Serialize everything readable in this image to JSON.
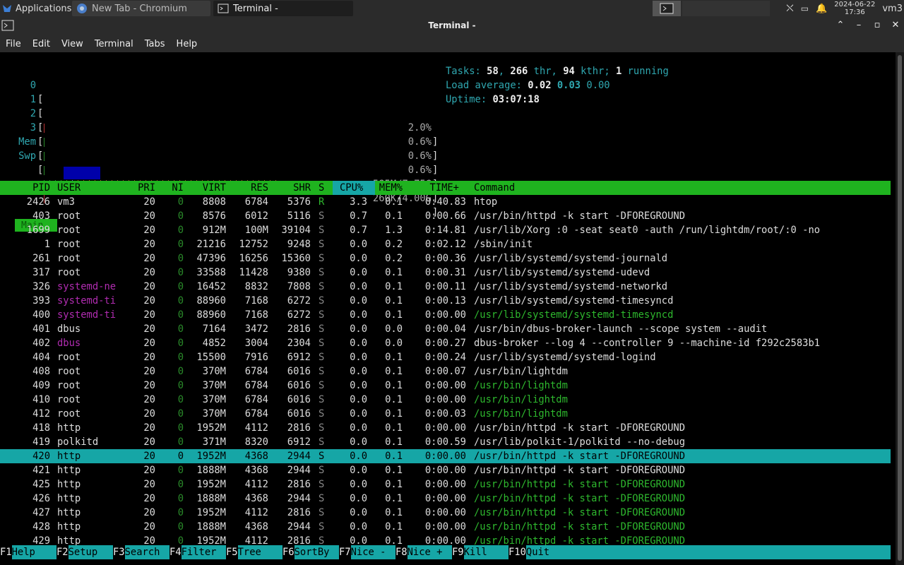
{
  "taskbar": {
    "apps_label": "Applications",
    "tasks": [
      {
        "label": "New Tab - Chromium"
      },
      {
        "label": "Terminal -"
      }
    ],
    "date": "2024-06-22",
    "time": "17:36",
    "user": "vm3"
  },
  "window": {
    "title": "Terminal -"
  },
  "menu": [
    "File",
    "Edit",
    "View",
    "Terminal",
    "Tabs",
    "Help"
  ],
  "meters": {
    "cpus": [
      {
        "label": "0",
        "value": "2.0%"
      },
      {
        "label": "1",
        "value": "0.6%"
      },
      {
        "label": "2",
        "value": "0.6%"
      },
      {
        "label": "3",
        "value": "0.6%"
      }
    ],
    "mem": {
      "label": "Mem",
      "value": "585M/7.75G"
    },
    "swp": {
      "label": "Swp",
      "value": "260K/4.00G"
    }
  },
  "summary": {
    "tasks_label": "Tasks:",
    "tasks": "58",
    "threads": "266",
    "threads_label": "thr,",
    "kthreads": "94",
    "kthreads_label": "kthr;",
    "running": "1",
    "running_label": "running",
    "load_label": "Load average:",
    "load1": "0.02",
    "load5": "0.03",
    "load15": "0.00",
    "uptime_label": "Uptime:",
    "uptime": "03:07:18"
  },
  "tabs": {
    "main": "Main"
  },
  "columns": [
    "PID",
    "USER",
    "PRI",
    "NI",
    "VIRT",
    "RES",
    "SHR",
    "S",
    "CPU%",
    "MEM%",
    "TIME+",
    "Command"
  ],
  "processes": [
    {
      "pid": "2426",
      "user": "vm3",
      "pri": "20",
      "ni": "0",
      "virt": "8808",
      "res": "6784",
      "shr": "5376",
      "s": "R",
      "cpu": "3.3",
      "mem": "0.1",
      "time": "0:40.83",
      "cmd": "htop"
    },
    {
      "pid": "403",
      "user": "root",
      "pri": "20",
      "ni": "0",
      "virt": "8576",
      "res": "6012",
      "shr": "5116",
      "s": "S",
      "cpu": "0.7",
      "mem": "0.1",
      "time": "0:00.66",
      "cmd": "/usr/bin/httpd -k start -DFOREGROUND"
    },
    {
      "pid": "1699",
      "user": "root",
      "pri": "20",
      "ni": "0",
      "virt": "912M",
      "res": "100M",
      "shr": "39104",
      "s": "S",
      "cpu": "0.7",
      "mem": "1.3",
      "time": "0:14.81",
      "cmd": "/usr/lib/Xorg :0 -seat seat0 -auth /run/lightdm/root/:0 -no"
    },
    {
      "pid": "1",
      "user": "root",
      "pri": "20",
      "ni": "0",
      "virt": "21216",
      "res": "12752",
      "shr": "9248",
      "s": "S",
      "cpu": "0.0",
      "mem": "0.2",
      "time": "0:02.12",
      "cmd": "/sbin/init"
    },
    {
      "pid": "261",
      "user": "root",
      "pri": "20",
      "ni": "0",
      "virt": "47396",
      "res": "16256",
      "shr": "15360",
      "s": "S",
      "cpu": "0.0",
      "mem": "0.2",
      "time": "0:00.36",
      "cmd": "/usr/lib/systemd/systemd-journald"
    },
    {
      "pid": "317",
      "user": "root",
      "pri": "20",
      "ni": "0",
      "virt": "33588",
      "res": "11428",
      "shr": "9380",
      "s": "S",
      "cpu": "0.0",
      "mem": "0.1",
      "time": "0:00.31",
      "cmd": "/usr/lib/systemd/systemd-udevd"
    },
    {
      "pid": "326",
      "user": "systemd-ne",
      "pri": "20",
      "ni": "0",
      "virt": "16452",
      "res": "8832",
      "shr": "7808",
      "s": "S",
      "cpu": "0.0",
      "mem": "0.1",
      "time": "0:00.11",
      "cmd": "/usr/lib/systemd/systemd-networkd"
    },
    {
      "pid": "393",
      "user": "systemd-ti",
      "pri": "20",
      "ni": "0",
      "virt": "88960",
      "res": "7168",
      "shr": "6272",
      "s": "S",
      "cpu": "0.0",
      "mem": "0.1",
      "time": "0:00.13",
      "cmd": "/usr/lib/systemd/systemd-timesyncd"
    },
    {
      "pid": "400",
      "user": "systemd-ti",
      "pri": "20",
      "ni": "0",
      "virt": "88960",
      "res": "7168",
      "shr": "6272",
      "s": "S",
      "cpu": "0.0",
      "mem": "0.1",
      "time": "0:00.00",
      "cmd": "/usr/lib/systemd/systemd-timesyncd"
    },
    {
      "pid": "401",
      "user": "dbus",
      "pri": "20",
      "ni": "0",
      "virt": "7164",
      "res": "3472",
      "shr": "2816",
      "s": "S",
      "cpu": "0.0",
      "mem": "0.0",
      "time": "0:00.04",
      "cmd": "/usr/bin/dbus-broker-launch --scope system --audit"
    },
    {
      "pid": "402",
      "user": "dbus",
      "pri": "20",
      "ni": "0",
      "virt": "4852",
      "res": "3004",
      "shr": "2304",
      "s": "S",
      "cpu": "0.0",
      "mem": "0.0",
      "time": "0:00.27",
      "cmd": "dbus-broker --log 4 --controller 9 --machine-id f292c2583b1"
    },
    {
      "pid": "404",
      "user": "root",
      "pri": "20",
      "ni": "0",
      "virt": "15500",
      "res": "7916",
      "shr": "6912",
      "s": "S",
      "cpu": "0.0",
      "mem": "0.1",
      "time": "0:00.24",
      "cmd": "/usr/lib/systemd/systemd-logind"
    },
    {
      "pid": "408",
      "user": "root",
      "pri": "20",
      "ni": "0",
      "virt": "370M",
      "res": "6784",
      "shr": "6016",
      "s": "S",
      "cpu": "0.0",
      "mem": "0.1",
      "time": "0:00.07",
      "cmd": "/usr/bin/lightdm"
    },
    {
      "pid": "409",
      "user": "root",
      "pri": "20",
      "ni": "0",
      "virt": "370M",
      "res": "6784",
      "shr": "6016",
      "s": "S",
      "cpu": "0.0",
      "mem": "0.1",
      "time": "0:00.00",
      "cmd": "/usr/bin/lightdm"
    },
    {
      "pid": "410",
      "user": "root",
      "pri": "20",
      "ni": "0",
      "virt": "370M",
      "res": "6784",
      "shr": "6016",
      "s": "S",
      "cpu": "0.0",
      "mem": "0.1",
      "time": "0:00.00",
      "cmd": "/usr/bin/lightdm"
    },
    {
      "pid": "412",
      "user": "root",
      "pri": "20",
      "ni": "0",
      "virt": "370M",
      "res": "6784",
      "shr": "6016",
      "s": "S",
      "cpu": "0.0",
      "mem": "0.1",
      "time": "0:00.03",
      "cmd": "/usr/bin/lightdm"
    },
    {
      "pid": "418",
      "user": "http",
      "pri": "20",
      "ni": "0",
      "virt": "1952M",
      "res": "4112",
      "shr": "2816",
      "s": "S",
      "cpu": "0.0",
      "mem": "0.1",
      "time": "0:00.00",
      "cmd": "/usr/bin/httpd -k start -DFOREGROUND"
    },
    {
      "pid": "419",
      "user": "polkitd",
      "pri": "20",
      "ni": "0",
      "virt": "371M",
      "res": "8320",
      "shr": "6912",
      "s": "S",
      "cpu": "0.0",
      "mem": "0.1",
      "time": "0:00.59",
      "cmd": "/usr/lib/polkit-1/polkitd --no-debug"
    },
    {
      "pid": "420",
      "user": "http",
      "pri": "20",
      "ni": "0",
      "virt": "1952M",
      "res": "4368",
      "shr": "2944",
      "s": "S",
      "cpu": "0.0",
      "mem": "0.1",
      "time": "0:00.00",
      "cmd": "/usr/bin/httpd -k start -DFOREGROUND"
    },
    {
      "pid": "421",
      "user": "http",
      "pri": "20",
      "ni": "0",
      "virt": "1888M",
      "res": "4368",
      "shr": "2944",
      "s": "S",
      "cpu": "0.0",
      "mem": "0.1",
      "time": "0:00.00",
      "cmd": "/usr/bin/httpd -k start -DFOREGROUND"
    },
    {
      "pid": "425",
      "user": "http",
      "pri": "20",
      "ni": "0",
      "virt": "1952M",
      "res": "4112",
      "shr": "2816",
      "s": "S",
      "cpu": "0.0",
      "mem": "0.1",
      "time": "0:00.00",
      "cmd": "/usr/bin/httpd -k start -DFOREGROUND"
    },
    {
      "pid": "426",
      "user": "http",
      "pri": "20",
      "ni": "0",
      "virt": "1888M",
      "res": "4368",
      "shr": "2944",
      "s": "S",
      "cpu": "0.0",
      "mem": "0.1",
      "time": "0:00.00",
      "cmd": "/usr/bin/httpd -k start -DFOREGROUND"
    },
    {
      "pid": "427",
      "user": "http",
      "pri": "20",
      "ni": "0",
      "virt": "1952M",
      "res": "4112",
      "shr": "2816",
      "s": "S",
      "cpu": "0.0",
      "mem": "0.1",
      "time": "0:00.00",
      "cmd": "/usr/bin/httpd -k start -DFOREGROUND"
    },
    {
      "pid": "428",
      "user": "http",
      "pri": "20",
      "ni": "0",
      "virt": "1888M",
      "res": "4368",
      "shr": "2944",
      "s": "S",
      "cpu": "0.0",
      "mem": "0.1",
      "time": "0:00.00",
      "cmd": "/usr/bin/httpd -k start -DFOREGROUND"
    },
    {
      "pid": "429",
      "user": "http",
      "pri": "20",
      "ni": "0",
      "virt": "1952M",
      "res": "4112",
      "shr": "2816",
      "s": "S",
      "cpu": "0.0",
      "mem": "0.1",
      "time": "0:00.00",
      "cmd": "/usr/bin/httpd -k start -DFOREGROUND"
    }
  ],
  "fkeys": [
    {
      "key": "F1",
      "label": "Help"
    },
    {
      "key": "F2",
      "label": "Setup"
    },
    {
      "key": "F3",
      "label": "Search"
    },
    {
      "key": "F4",
      "label": "Filter"
    },
    {
      "key": "F5",
      "label": "Tree"
    },
    {
      "key": "F6",
      "label": "SortBy"
    },
    {
      "key": "F7",
      "label": "Nice -"
    },
    {
      "key": "F8",
      "label": "Nice +"
    },
    {
      "key": "F9",
      "label": "Kill"
    },
    {
      "key": "F10",
      "label": "Quit"
    }
  ],
  "colors": {
    "accent_green": "#1fb31f",
    "selection": "#16a6a6",
    "cyan": "#2fa7b0",
    "purple": "#b02cb0"
  }
}
